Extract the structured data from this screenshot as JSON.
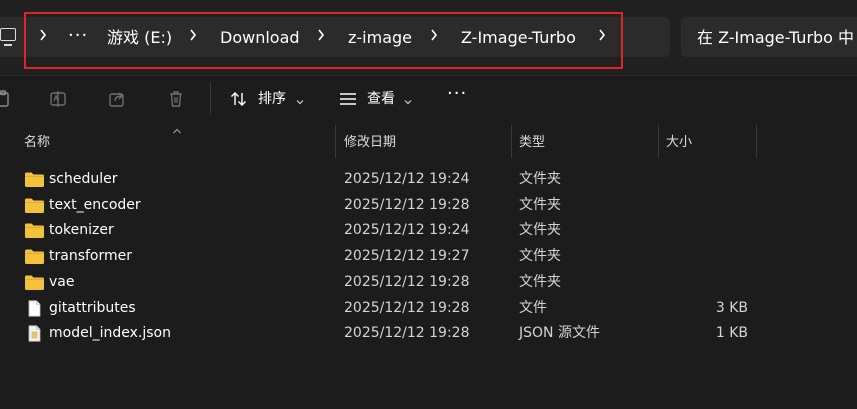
{
  "address_bar": {
    "crumbs": [
      "游戏 (E:)",
      "Download",
      "z-image",
      "Z-Image-Turbo"
    ],
    "overflow_label": "···",
    "highlight_color": "#e0242c"
  },
  "search": {
    "placeholder": "在 Z-Image-Turbo 中"
  },
  "toolbar": {
    "sort_label": "排序",
    "view_label": "查看",
    "more_label": "···",
    "icons": [
      "paste-icon",
      "rename-icon",
      "share-icon",
      "delete-icon",
      "sort-icon",
      "view-icon"
    ]
  },
  "columns": {
    "name": "名称",
    "modified": "修改日期",
    "type": "类型",
    "size": "大小"
  },
  "files": [
    {
      "name": "scheduler",
      "modified": "2025/12/12 19:24",
      "type": "文件夹",
      "size": "",
      "icon": "folder-icon"
    },
    {
      "name": "text_encoder",
      "modified": "2025/12/12 19:28",
      "type": "文件夹",
      "size": "",
      "icon": "folder-icon"
    },
    {
      "name": "tokenizer",
      "modified": "2025/12/12 19:24",
      "type": "文件夹",
      "size": "",
      "icon": "folder-icon"
    },
    {
      "name": "transformer",
      "modified": "2025/12/12 19:27",
      "type": "文件夹",
      "size": "",
      "icon": "folder-icon"
    },
    {
      "name": "vae",
      "modified": "2025/12/12 19:28",
      "type": "文件夹",
      "size": "",
      "icon": "folder-icon"
    },
    {
      "name": "gitattributes",
      "modified": "2025/12/12 19:28",
      "type": "文件",
      "size": "3 KB",
      "icon": "file-icon"
    },
    {
      "name": "model_index.json",
      "modified": "2025/12/12 19:28",
      "type": "JSON 源文件",
      "size": "1 KB",
      "icon": "json-file-icon"
    }
  ],
  "colors": {
    "folder": "#f3c23c",
    "background": "#1c1c1c",
    "text": "#ffffff"
  }
}
